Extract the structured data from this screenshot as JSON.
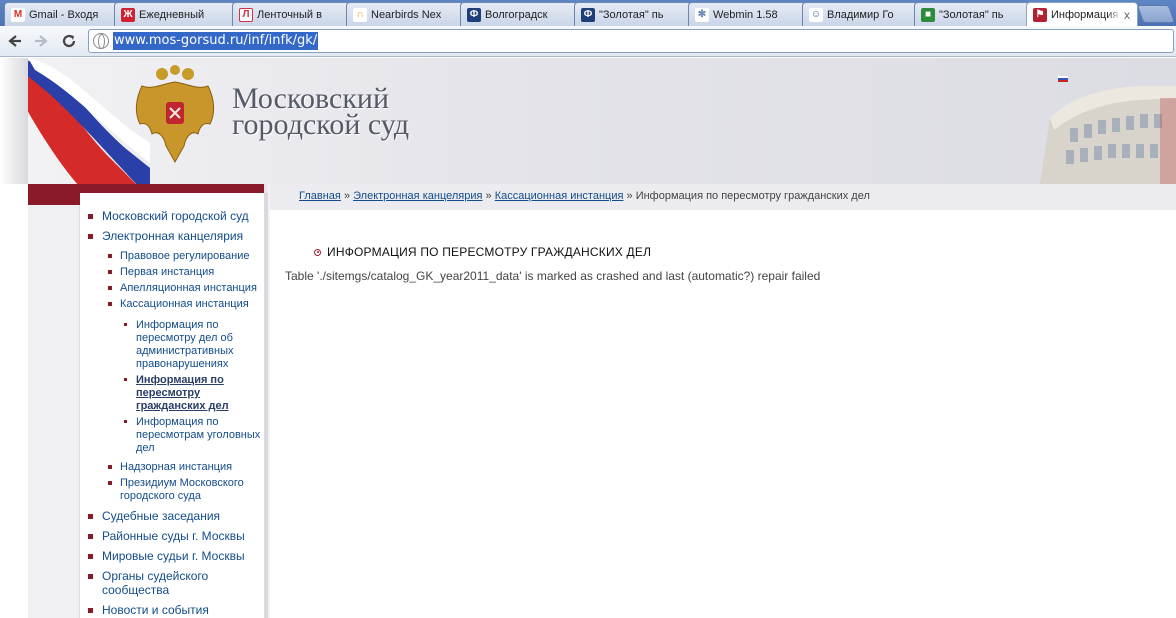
{
  "browser": {
    "tabs": [
      {
        "title": "Gmail - Входя",
        "icon": "gmail-icon",
        "color": "#d93025",
        "glyph": "M"
      },
      {
        "title": "Ежедневный",
        "icon": "ej-icon",
        "color": "#cc2233",
        "glyph": "Ж"
      },
      {
        "title": "Ленточный в",
        "icon": "lenta-icon",
        "color": "#cc3344",
        "glyph": "Л"
      },
      {
        "title": "Nearbirds Nex",
        "icon": "rainbow-icon",
        "color": "#e8a020",
        "glyph": "∩"
      },
      {
        "title": "Волгоградск",
        "icon": "f-icon",
        "color": "#1f3f7a",
        "glyph": "Ф"
      },
      {
        "title": "\"Золотая\" пь",
        "icon": "f-icon",
        "color": "#1f3f7a",
        "glyph": "Ф"
      },
      {
        "title": "Webmin 1.58",
        "icon": "webmin-icon",
        "color": "#5f7fb0",
        "glyph": "✻"
      },
      {
        "title": "Владимир Го",
        "icon": "person-icon",
        "color": "#3a5f9a",
        "glyph": "☺"
      },
      {
        "title": "\"Золотая\" пь",
        "icon": "green-square-icon",
        "color": "#2e8b3e",
        "glyph": "■"
      },
      {
        "title": "Информация",
        "icon": "court-icon",
        "color": "#b22233",
        "glyph": "⚑"
      }
    ],
    "tab_close": "x",
    "url": "www.mos-gorsud.ru/inf/infk/gk/"
  },
  "header": {
    "title_line1": "Московский",
    "title_line2": "городской суд"
  },
  "breadcrumb": {
    "items": [
      "Главная",
      "Электронная канцелярия",
      "Кассационная инстанция"
    ],
    "separator": "»",
    "current": "Информация по пересмотру гражданских дел"
  },
  "sidebar": {
    "items": [
      {
        "label": "Московский городской суд"
      },
      {
        "label": "Электронная канцелярия"
      },
      {
        "label": "Судебные заседания"
      },
      {
        "label": "Районные суды г. Москвы"
      },
      {
        "label": "Мировые судьи г. Москвы"
      },
      {
        "label": "Органы судейского сообщества"
      },
      {
        "label": "Новости и события"
      }
    ],
    "sub": [
      {
        "label": "Правовое регулирование"
      },
      {
        "label": "Первая инстанция"
      },
      {
        "label": "Апелляционная инстанция"
      },
      {
        "label": "Кассационная инстанция"
      },
      {
        "label": "Надзорная инстанция"
      },
      {
        "label": "Президиум Московского городского суда"
      }
    ],
    "subsub": [
      {
        "label": "Информация по пересмотру дел об административных правонарушениях"
      },
      {
        "label": "Информация по пересмотру гражданских дел"
      },
      {
        "label": "Информация по пересмотрам уголовных дел"
      }
    ]
  },
  "content": {
    "heading": "ИНФОРМАЦИЯ ПО ПЕРЕСМОТРУ ГРАЖДАНСКИХ ДЕЛ",
    "error": "Table './sitemgs/catalog_GK_year2011_data' is marked as crashed and last (automatic?) repair failed"
  },
  "colors": {
    "accent_red": "#8a1a2a",
    "link_blue": "#124c8a",
    "selection_blue": "#3368c9"
  }
}
